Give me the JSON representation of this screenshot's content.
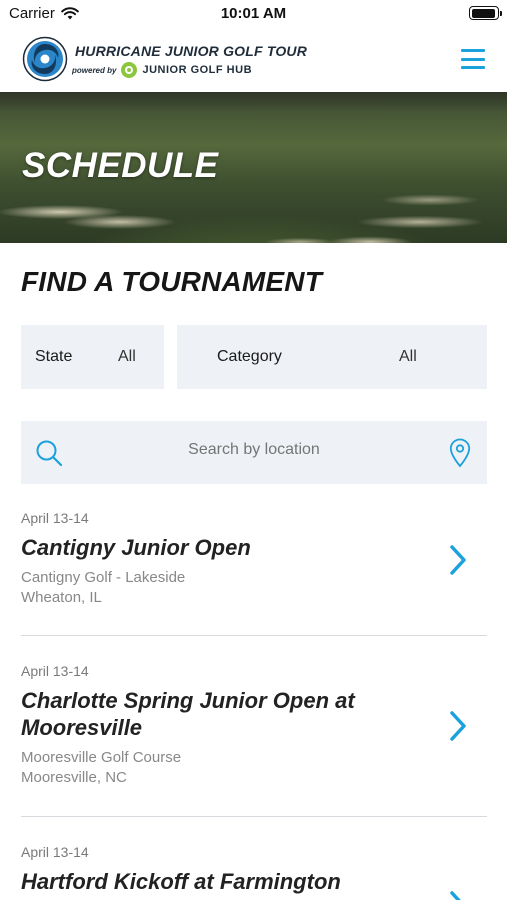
{
  "status_bar": {
    "carrier": "Carrier",
    "time": "10:01 AM",
    "battery_level": 0.95
  },
  "header": {
    "title": "HURRICANE JUNIOR GOLF TOUR",
    "powered_by": "powered by",
    "partner": "JUNIOR GOLF HUB",
    "accent_color": "#1ba1dc"
  },
  "hero": {
    "title": "SCHEDULE"
  },
  "finder": {
    "title": "FIND A TOURNAMENT",
    "state": {
      "label": "State",
      "value": "All"
    },
    "category": {
      "label": "Category",
      "value": "All"
    },
    "search_placeholder": "Search by location"
  },
  "tournaments": [
    {
      "date": "April 13-14",
      "name": "Cantigny Junior Open",
      "course": "Cantigny Golf - Lakeside",
      "city": "Wheaton, IL"
    },
    {
      "date": "April 13-14",
      "name": "Charlotte Spring Junior Open at Mooresville",
      "course": "Mooresville Golf Course",
      "city": "Mooresville, NC"
    },
    {
      "date": "April 13-14",
      "name": "Hartford Kickoff at Farmington",
      "course": "",
      "city": ""
    }
  ]
}
